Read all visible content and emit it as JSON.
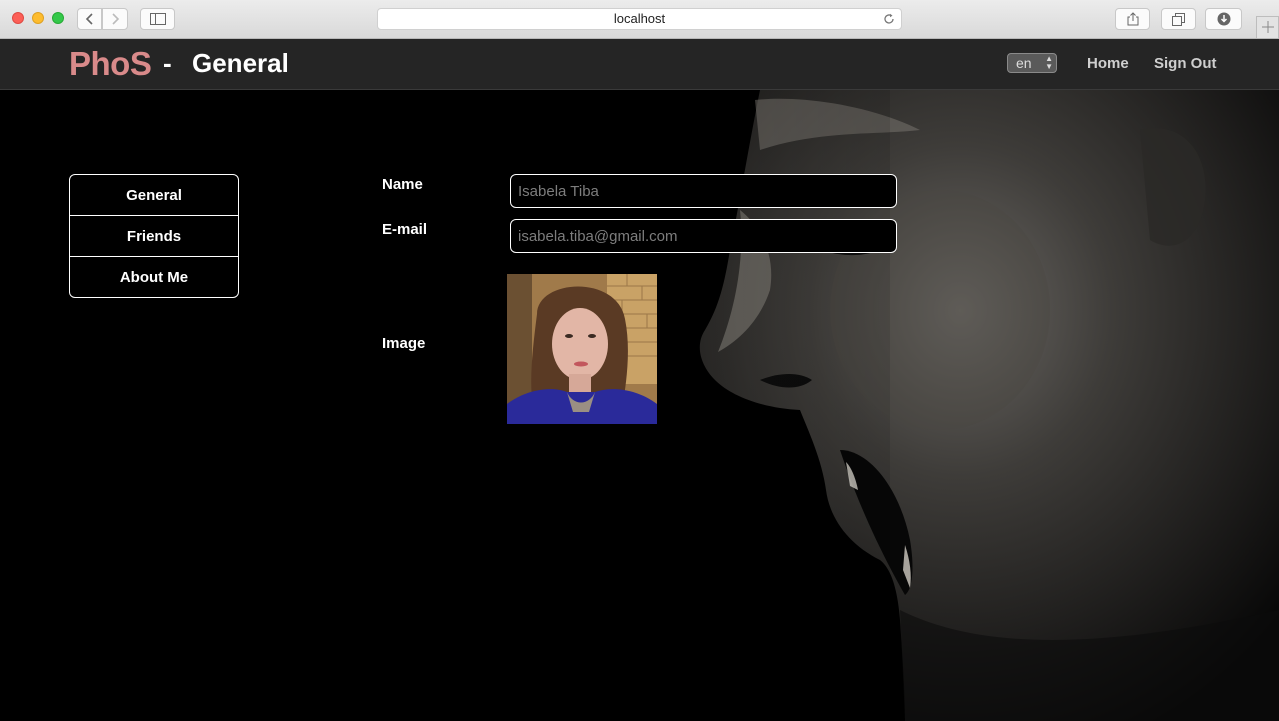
{
  "browser": {
    "url": "localhost"
  },
  "header": {
    "brand": "PhoS",
    "separator": "-",
    "page_title": "General",
    "language_selected": "en",
    "nav": {
      "home": "Home",
      "sign_out": "Sign Out"
    }
  },
  "sidebar": {
    "items": [
      {
        "label": "General"
      },
      {
        "label": "Friends"
      },
      {
        "label": "About Me"
      }
    ]
  },
  "form": {
    "name_label": "Name",
    "name_value": "Isabela Tiba",
    "email_label": "E-mail",
    "email_value": "isabela.tiba@gmail.com",
    "image_label": "Image"
  },
  "colors": {
    "brand": "#d98a8a",
    "appbar": "#252525",
    "background": "#000000"
  }
}
